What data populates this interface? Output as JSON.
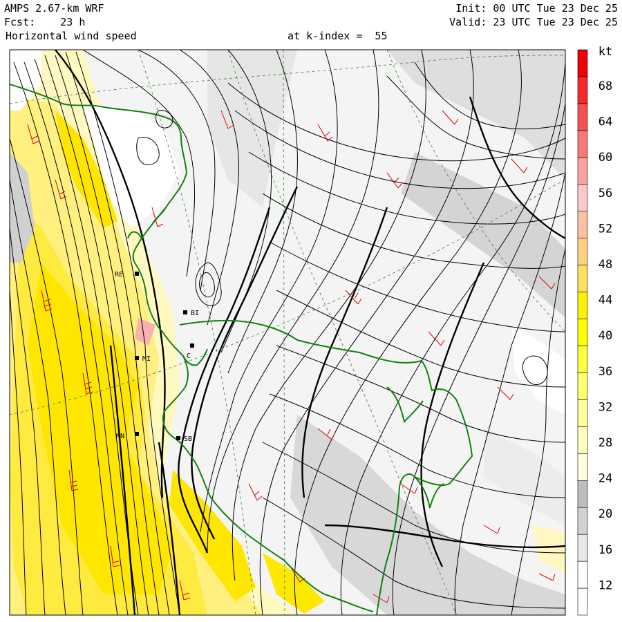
{
  "header": {
    "model": "AMPS 2.67-km WRF",
    "fcst": "Fcst:    23 h",
    "field": "Horizontal wind speed",
    "level": "at k-index =  55",
    "init": "Init: 00 UTC Tue 23 Dec 25",
    "valid": "Valid: 23 UTC Tue 23 Dec 25"
  },
  "colorbar": {
    "unit": "kt",
    "labels": [
      "68",
      "64",
      "60",
      "56",
      "52",
      "48",
      "44",
      "40",
      "36",
      "32",
      "28",
      "24",
      "20",
      "16",
      "12"
    ],
    "colors": [
      "#ffffff",
      "#ffffff",
      "#e8e8e8",
      "#d2d2d2",
      "#bebebe",
      "#ffffe0",
      "#ffffc0",
      "#ffff9c",
      "#ffff70",
      "#ffff40",
      "#ffff00",
      "#fff000",
      "#fde060",
      "#fdd080",
      "#fdc0a0",
      "#fdc8c8",
      "#fca0a0",
      "#fa7878",
      "#f85050",
      "#f62828",
      "#f00000"
    ],
    "top_color": "#f00000"
  },
  "stations": [
    {
      "label": "BI"
    },
    {
      "label": "SB"
    },
    {
      "label": "RE"
    },
    {
      "label": "MI"
    },
    {
      "label": "C"
    },
    {
      "label": "MN"
    }
  ],
  "colors": {
    "coast": "#108010",
    "barb": "#e00000",
    "streamline": "#000000",
    "grid": "#2a8a2a"
  }
}
